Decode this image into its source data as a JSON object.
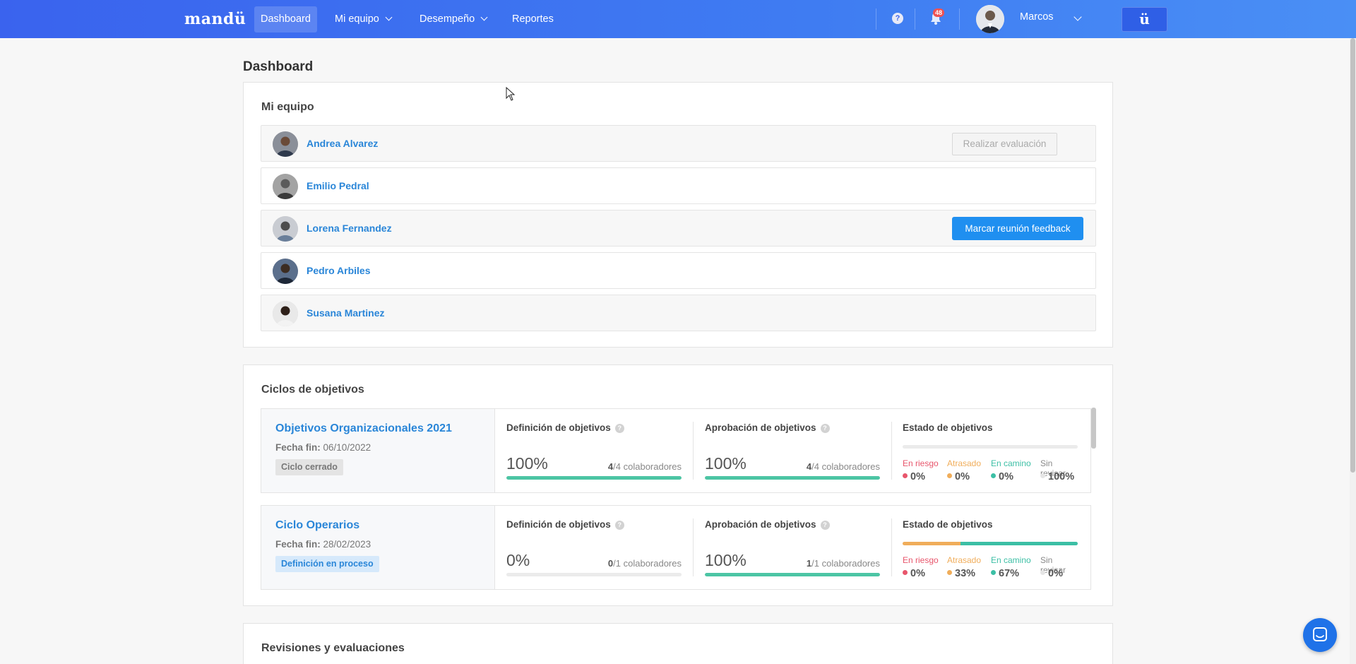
{
  "navbar": {
    "brand": "mandü",
    "items": [
      {
        "label": "Dashboard",
        "active": true,
        "dropdown": false
      },
      {
        "label": "Mi equipo",
        "active": false,
        "dropdown": true
      },
      {
        "label": "Desempeño",
        "active": false,
        "dropdown": true
      },
      {
        "label": "Reportes",
        "active": false,
        "dropdown": false
      }
    ],
    "notifications_count": "48",
    "user_name": "Marcos",
    "app_button": "ü"
  },
  "page": {
    "title": "Dashboard"
  },
  "team": {
    "title": "Mi equipo",
    "members": [
      {
        "name": "Andrea Alvarez",
        "action": "Realizar evaluación",
        "action_enabled": false
      },
      {
        "name": "Emilio Pedral"
      },
      {
        "name": "Lorena Fernandez",
        "action": "Marcar reunión feedback",
        "action_enabled": true
      },
      {
        "name": "Pedro Arbiles"
      },
      {
        "name": "Susana Martinez"
      }
    ]
  },
  "cycles": {
    "title": "Ciclos de objetivos",
    "items": [
      {
        "name": "Objetivos Organizacionales 2021",
        "end_label": "Fecha fin:",
        "end_date": "06/10/2022",
        "tag": "Ciclo cerrado",
        "definition": {
          "title": "Definición de objetivos",
          "pct": "100%",
          "done": "4",
          "total": "/4 colaboradores",
          "fraction": 1.0
        },
        "approval": {
          "title": "Aprobación de objetivos",
          "pct": "100%",
          "done": "4",
          "total": "/4 colaboradores",
          "fraction": 1.0
        },
        "status": {
          "title": "Estado de objetivos",
          "labels": [
            "En riesgo",
            "Atrasado",
            "En camino",
            "Sin revisar"
          ],
          "values": [
            "0%",
            "0%",
            "0%",
            "100%"
          ],
          "fractions": [
            0,
            0,
            0,
            1
          ]
        }
      },
      {
        "name": "Ciclo Operarios",
        "end_label": "Fecha fin:",
        "end_date": "28/02/2023",
        "tag": "Definición en proceso",
        "definition": {
          "title": "Definición de objetivos",
          "pct": "0%",
          "done": "0",
          "total": "/1 colaboradores",
          "fraction": 0.0
        },
        "approval": {
          "title": "Aprobación de objetivos",
          "pct": "100%",
          "done": "1",
          "total": "/1 colaboradores",
          "fraction": 1.0
        },
        "status": {
          "title": "Estado de objetivos",
          "labels": [
            "En riesgo",
            "Atrasado",
            "En camino",
            "Sin revisar"
          ],
          "values": [
            "0%",
            "33%",
            "67%",
            "0%"
          ],
          "fractions": [
            0,
            0.33,
            0.67,
            0
          ]
        }
      }
    ]
  },
  "reviews": {
    "title": "Revisiones y evaluaciones"
  },
  "colors": {
    "navbar": "#3a63ee",
    "link": "#2a86d8",
    "primary_button": "#1f8ff0",
    "progress": "#4cc5a4",
    "risk": "#e8566c",
    "late": "#f0ad5a",
    "on_track": "#3cbfa5",
    "unreviewed": "#e5e5e5"
  }
}
